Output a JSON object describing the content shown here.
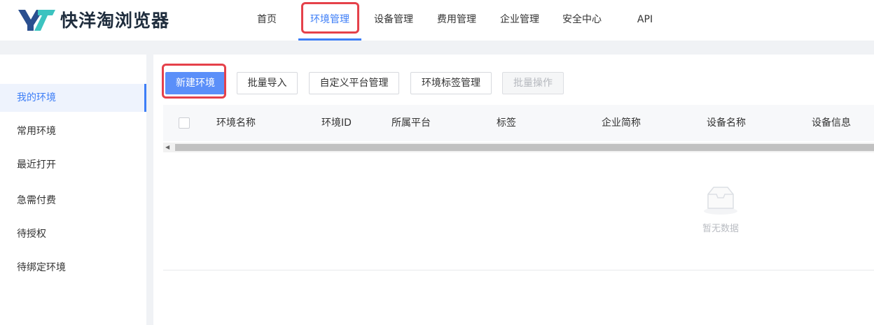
{
  "app": {
    "logo_text": "快洋淘浏览器"
  },
  "nav": {
    "items": [
      "首页",
      "环境管理",
      "设备管理",
      "费用管理",
      "企业管理",
      "安全中心",
      "API"
    ],
    "active_index": 1
  },
  "sidebar": {
    "items": [
      "我的环境",
      "常用环境",
      "最近打开",
      "急需付费",
      "待授权",
      "待绑定环境"
    ],
    "active_index": 0
  },
  "toolbar": {
    "new_env": "新建环境",
    "batch_import": "批量导入",
    "custom_platform": "自定义平台管理",
    "tag_manage": "环境标签管理",
    "batch_ops": "批量操作"
  },
  "table": {
    "columns": [
      "环境名称",
      "环境ID",
      "所属平台",
      "标签",
      "企业简称",
      "设备名称",
      "设备信息"
    ],
    "rows": []
  },
  "empty_state": {
    "text": "暂无数据"
  },
  "colors": {
    "accent": "#3d7ef7",
    "primary_button": "#5b8ff9",
    "highlight_box": "#e5414a",
    "logo_dark": "#2a4f8f",
    "logo_teal": "#3cc3c0"
  }
}
